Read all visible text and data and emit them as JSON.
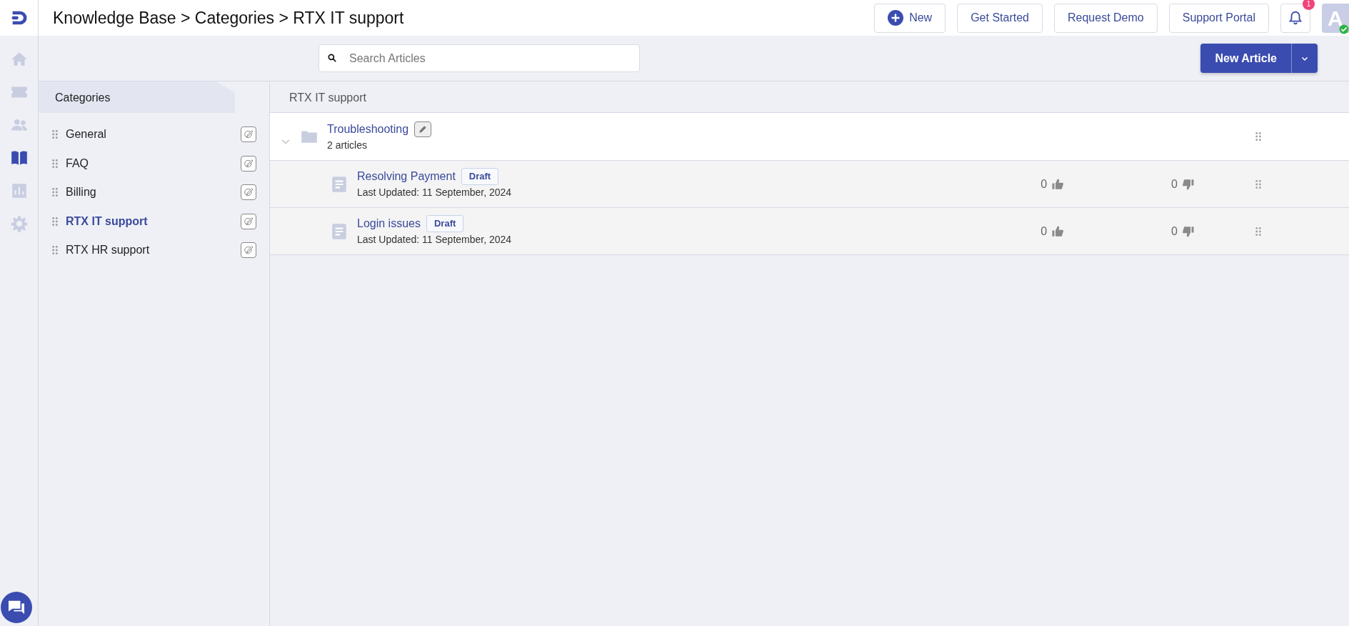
{
  "breadcrumb": "Knowledge Base > Categories > RTX IT support",
  "top_buttons": [
    {
      "kind": "new",
      "label": "New"
    },
    {
      "kind": "plain",
      "label": "Get Started"
    },
    {
      "kind": "plain",
      "label": "Request Demo"
    },
    {
      "kind": "plain",
      "label": "Support Portal"
    }
  ],
  "notifications": {
    "count": "1"
  },
  "avatar": {
    "letter": "A",
    "online": true
  },
  "rail": [
    {
      "kind": "home",
      "selected": false
    },
    {
      "kind": "ticket",
      "selected": false
    },
    {
      "kind": "people",
      "selected": false
    },
    {
      "kind": "book",
      "selected": true
    },
    {
      "kind": "chart",
      "selected": false
    },
    {
      "kind": "gear",
      "selected": false
    }
  ],
  "search": {
    "placeholder": "Search Articles"
  },
  "new_article_button": "New Article",
  "categories": {
    "title": "Categories",
    "items": [
      {
        "label": "General",
        "selected": false
      },
      {
        "label": "FAQ",
        "selected": false
      },
      {
        "label": "Billing",
        "selected": false
      },
      {
        "label": "RTX IT support",
        "selected": true
      },
      {
        "label": "RTX HR support",
        "selected": false
      }
    ]
  },
  "content": {
    "title": "RTX IT support",
    "folders": [
      {
        "name": "Troubleshooting",
        "count": "2 articles",
        "expanded": true,
        "articles": [
          {
            "title": "Resolving Payment",
            "status": "Draft",
            "updated": "Last Updated: 11 September, 2024",
            "likes": "0",
            "dislikes": "0"
          },
          {
            "title": "Login issues",
            "status": "Draft",
            "updated": "Last Updated: 11 September, 2024",
            "likes": "0",
            "dislikes": "0"
          }
        ]
      }
    ]
  }
}
